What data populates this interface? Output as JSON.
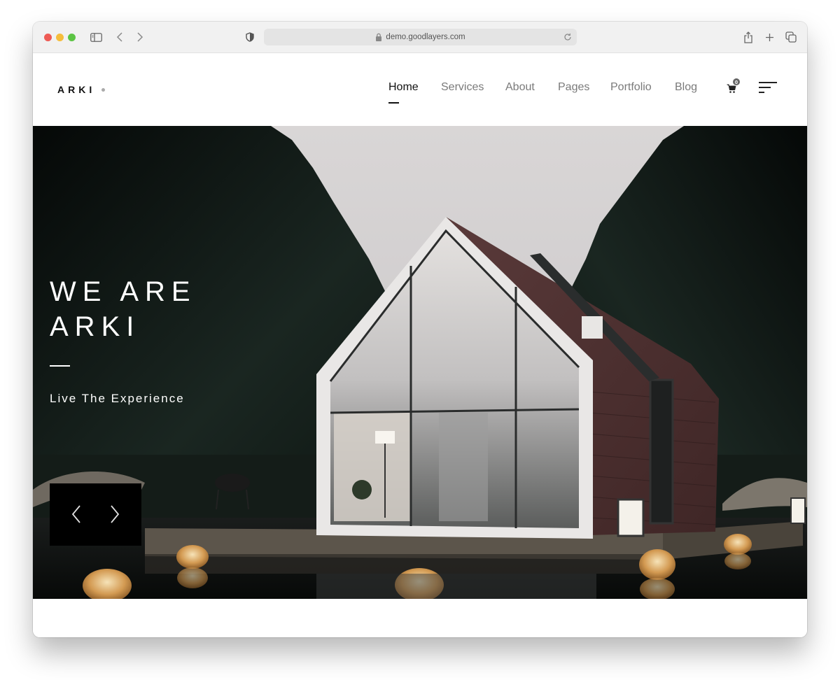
{
  "browser": {
    "url": "demo.goodlayers.com",
    "icons": [
      "sidebar-toggle-icon",
      "back-icon",
      "forward-icon",
      "privacy-shield-icon",
      "lock-icon",
      "reload-icon",
      "share-icon",
      "new-tab-icon",
      "tab-overview-icon"
    ]
  },
  "site": {
    "logo": "ARKI",
    "nav": [
      {
        "label": "Home",
        "active": true
      },
      {
        "label": "Services",
        "active": false
      },
      {
        "label": "About",
        "active": false
      },
      {
        "label": "Pages",
        "active": false
      },
      {
        "label": "Portfolio",
        "active": false
      },
      {
        "label": "Blog",
        "active": false
      }
    ],
    "cart_count": "0"
  },
  "hero": {
    "title_line1": "WE ARE",
    "title_line2": "ARKI",
    "subtitle": "Live The Experience",
    "image_description": "Modern gabled glass cabin with dark wood siding at dusk, surrounded by pine forest, on a wooden deck over dark water with floating wicker lanterns"
  },
  "colors": {
    "accent": "#111111",
    "nav_inactive": "#7a7a7a",
    "hero_overlay_text": "#ffffff"
  }
}
